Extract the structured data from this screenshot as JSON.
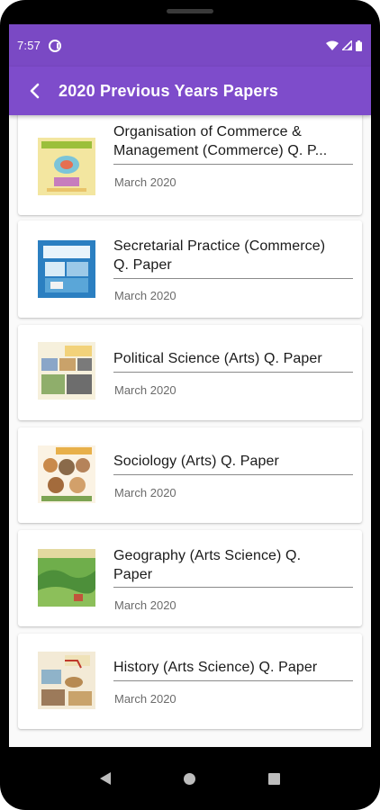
{
  "status_bar": {
    "time": "7:57",
    "icons": [
      "app-notification-icon",
      "wifi-icon",
      "signal-icon",
      "battery-icon"
    ]
  },
  "app_bar": {
    "title": "2020 Previous Years Papers",
    "back_icon": "back-arrow-icon",
    "color": "#7e4ccb"
  },
  "papers": [
    {
      "title_lines": [
        "Organisation of Commerce &",
        "Management (Commerce) Q. P..."
      ],
      "date": "March 2020"
    },
    {
      "title_lines": [
        "Secretarial Practice (Commerce)",
        "Q. Paper"
      ],
      "date": "March 2020"
    },
    {
      "title_lines": [
        "Political Science (Arts) Q. Paper"
      ],
      "date": "March 2020"
    },
    {
      "title_lines": [
        "Sociology (Arts) Q. Paper"
      ],
      "date": "March 2020"
    },
    {
      "title_lines": [
        "Geography (Arts Science) Q.",
        "Paper"
      ],
      "date": "March 2020"
    },
    {
      "title_lines": [
        "History (Arts Science) Q. Paper"
      ],
      "date": "March 2020"
    }
  ],
  "nav_bar": {
    "icons": [
      "nav-back-icon",
      "nav-home-icon",
      "nav-recents-icon"
    ]
  }
}
